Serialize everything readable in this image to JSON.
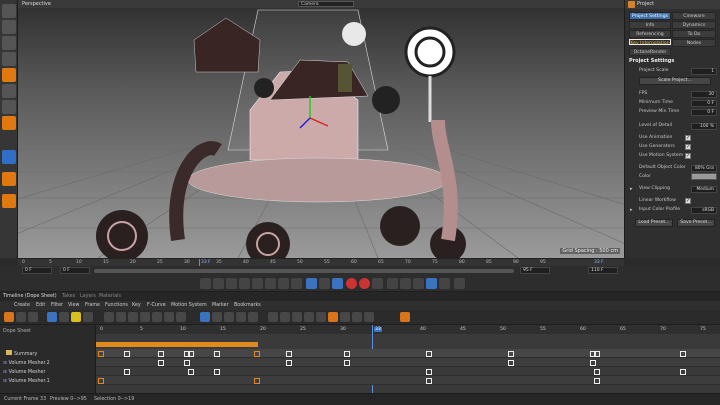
{
  "viewport": {
    "title": "Perspective",
    "camera": "Camera",
    "grid_spacing": "Grid Spacing : 500 cm"
  },
  "project_panel": {
    "title": "Project",
    "tabs": [
      "Project Settings",
      "Cineware",
      "Info",
      "Dynamics",
      "Referencing",
      "To Do",
      "Key Interpolation",
      "Nodes",
      "OctaneRender"
    ],
    "heading": "Project Settings",
    "project_scale_label": "Project Scale",
    "project_scale_value": "1",
    "scale_project_button": "Scale Project...",
    "fps_label": "FPS",
    "fps_value": "30",
    "min_time_label": "Minimum Time",
    "min_time_value": "0 F",
    "preview_min_label": "Preview Min Time",
    "preview_min_value": "0 F",
    "lod_label": "Level of Detail",
    "lod_value": "100 %",
    "use_animation_label": "Use Animation",
    "use_generators_label": "Use Generators",
    "use_motion_label": "Use Motion System",
    "default_color_label": "Default Object Color",
    "default_color_value": "80% Gra",
    "color_label": "Color",
    "view_clipping_label": "View Clipping",
    "view_clipping_value": "Medium",
    "linear_workflow_label": "Linear Workflow",
    "input_color_label": "Input Color Profile",
    "input_color_value": "sRGB",
    "load_preset_button": "Load Preset...",
    "save_preset_button": "Save Preset..."
  },
  "timeline_ruler": {
    "ticks": [
      "0",
      "5",
      "10",
      "15",
      "20",
      "25",
      "30",
      "33 F",
      "35",
      "40",
      "45",
      "50",
      "55",
      "60",
      "65",
      "70",
      "75",
      "80",
      "85",
      "90",
      "95"
    ],
    "current_frame": "33 F"
  },
  "frame_fields": {
    "start": "0 F",
    "preview_start": "0 F",
    "preview_end": "95 F",
    "end": "110 F"
  },
  "panel_tabs": [
    "Timeline (Dope Sheet)",
    "Takes",
    "Layers",
    "Materials"
  ],
  "menubar": [
    "Create",
    "Edit",
    "Filter",
    "View",
    "Frame",
    "Functions",
    "Key",
    "F-Curve",
    "Motion System",
    "Marker",
    "Bookmarks"
  ],
  "dope_sheet": {
    "title": "Dope Sheet",
    "frame_ticks": [
      "0",
      "5",
      "10",
      "15",
      "20",
      "25",
      "30",
      "35",
      "40",
      "45",
      "50",
      "55",
      "60",
      "65",
      "70",
      "75"
    ],
    "current_frame": "33",
    "tracks": [
      "Summary",
      "Volume Mesher.2",
      "Volume Mesher",
      "Volume Mesher.1"
    ]
  },
  "status_bar": {
    "current_frame": "Current Frame  33",
    "preview": "Preview  0-->95",
    "selection": "Selection  0-->19"
  }
}
